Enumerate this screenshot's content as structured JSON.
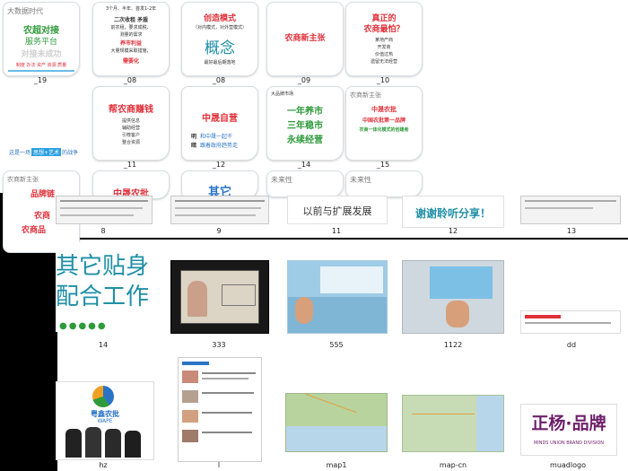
{
  "slides_top": [
    {
      "id": "_19",
      "lines": [
        "大数据时代",
        "农超对接",
        "服务平台",
        "对接未成功",
        "制度 办法 资产 资源 质量"
      ]
    },
    {
      "id": "_08",
      "lines": [
        "3个月、半年、首发1-2年",
        "二次收租 矛盾",
        "前农租，要求成税、",
        "测量的需求",
        "养市利益",
        "大量规模采取措施，",
        "需要化"
      ]
    },
    {
      "id": "_08b",
      "lines": [
        "创造模式",
        "（对内模式，对外营模式）",
        "概念",
        "最好最后期落地"
      ]
    },
    {
      "id": "_09",
      "lines": [
        "农商新主张"
      ]
    },
    {
      "id": "_10",
      "lines": [
        "真正的",
        "农商最怕？",
        "某地产商",
        "开发商",
        "价值过热",
        "遗留无法经营"
      ]
    },
    {
      "id": "_11",
      "lines": [
        "帮农商赚钱",
        "提供信息",
        "辅助经营",
        "引荐客户",
        "整合资源"
      ]
    },
    {
      "id": "_12",
      "lines": [
        "中晟自营",
        "明",
        "和中晟一起干",
        "暗",
        "跟着政府趋势走"
      ]
    },
    {
      "id": "_14",
      "lines": [
        "大品牌市场",
        "一年养市",
        "三年稳市",
        "永续经营"
      ]
    },
    {
      "id": "_15",
      "lines": [
        "农商新主张",
        "中晟农批",
        "中国农批第一品牌",
        "农商一体化模式的创建者"
      ]
    }
  ],
  "slide_captions": [
    "_19",
    "_08",
    "_08",
    "_09",
    "_10",
    "_11",
    "_12",
    "_14",
    "_15"
  ],
  "strip": {
    "left_text": "这是一场",
    "highlight": "思想+艺术",
    "right_text": "的战争"
  },
  "row3": [
    {
      "lines": [
        "农商新主张",
        "品牌链",
        "农商",
        "农商品"
      ]
    },
    {
      "lines": [
        "中晟农批"
      ]
    },
    {
      "lines": [
        "其它"
      ]
    },
    {
      "lines": [
        "未来性"
      ]
    },
    {
      "lines": [
        "未来性"
      ]
    }
  ],
  "folder_row1": [
    {
      "caption": "8",
      "text": ""
    },
    {
      "caption": "9",
      "text": ""
    },
    {
      "caption": "11",
      "text": "以前与扩展发展"
    },
    {
      "caption": "12",
      "text": "谢谢聆听分享！"
    },
    {
      "caption": "13",
      "text": ""
    }
  ],
  "folder_row2": [
    {
      "caption": "14",
      "title1": "其它贴身",
      "title2": "配合工作"
    },
    {
      "caption": "333"
    },
    {
      "caption": "555"
    },
    {
      "caption": "1122"
    },
    {
      "caption": "dd"
    }
  ],
  "folder_row3": [
    {
      "caption": "hz",
      "logo": "粤鑫农批",
      "logo_en": "WAPE"
    },
    {
      "caption": "l"
    },
    {
      "caption": "map1"
    },
    {
      "caption": "map-cn"
    },
    {
      "caption": "muadlogo",
      "logo_cn": "正杨·品牌",
      "logo_en": "MINDS UNION BRAND DIVISION"
    }
  ],
  "colors": {
    "red": "#e0303a",
    "green": "#2f9a3a",
    "teal": "#1f8fa6",
    "blue": "#2a74c7",
    "purple": "#6d1f6a"
  }
}
